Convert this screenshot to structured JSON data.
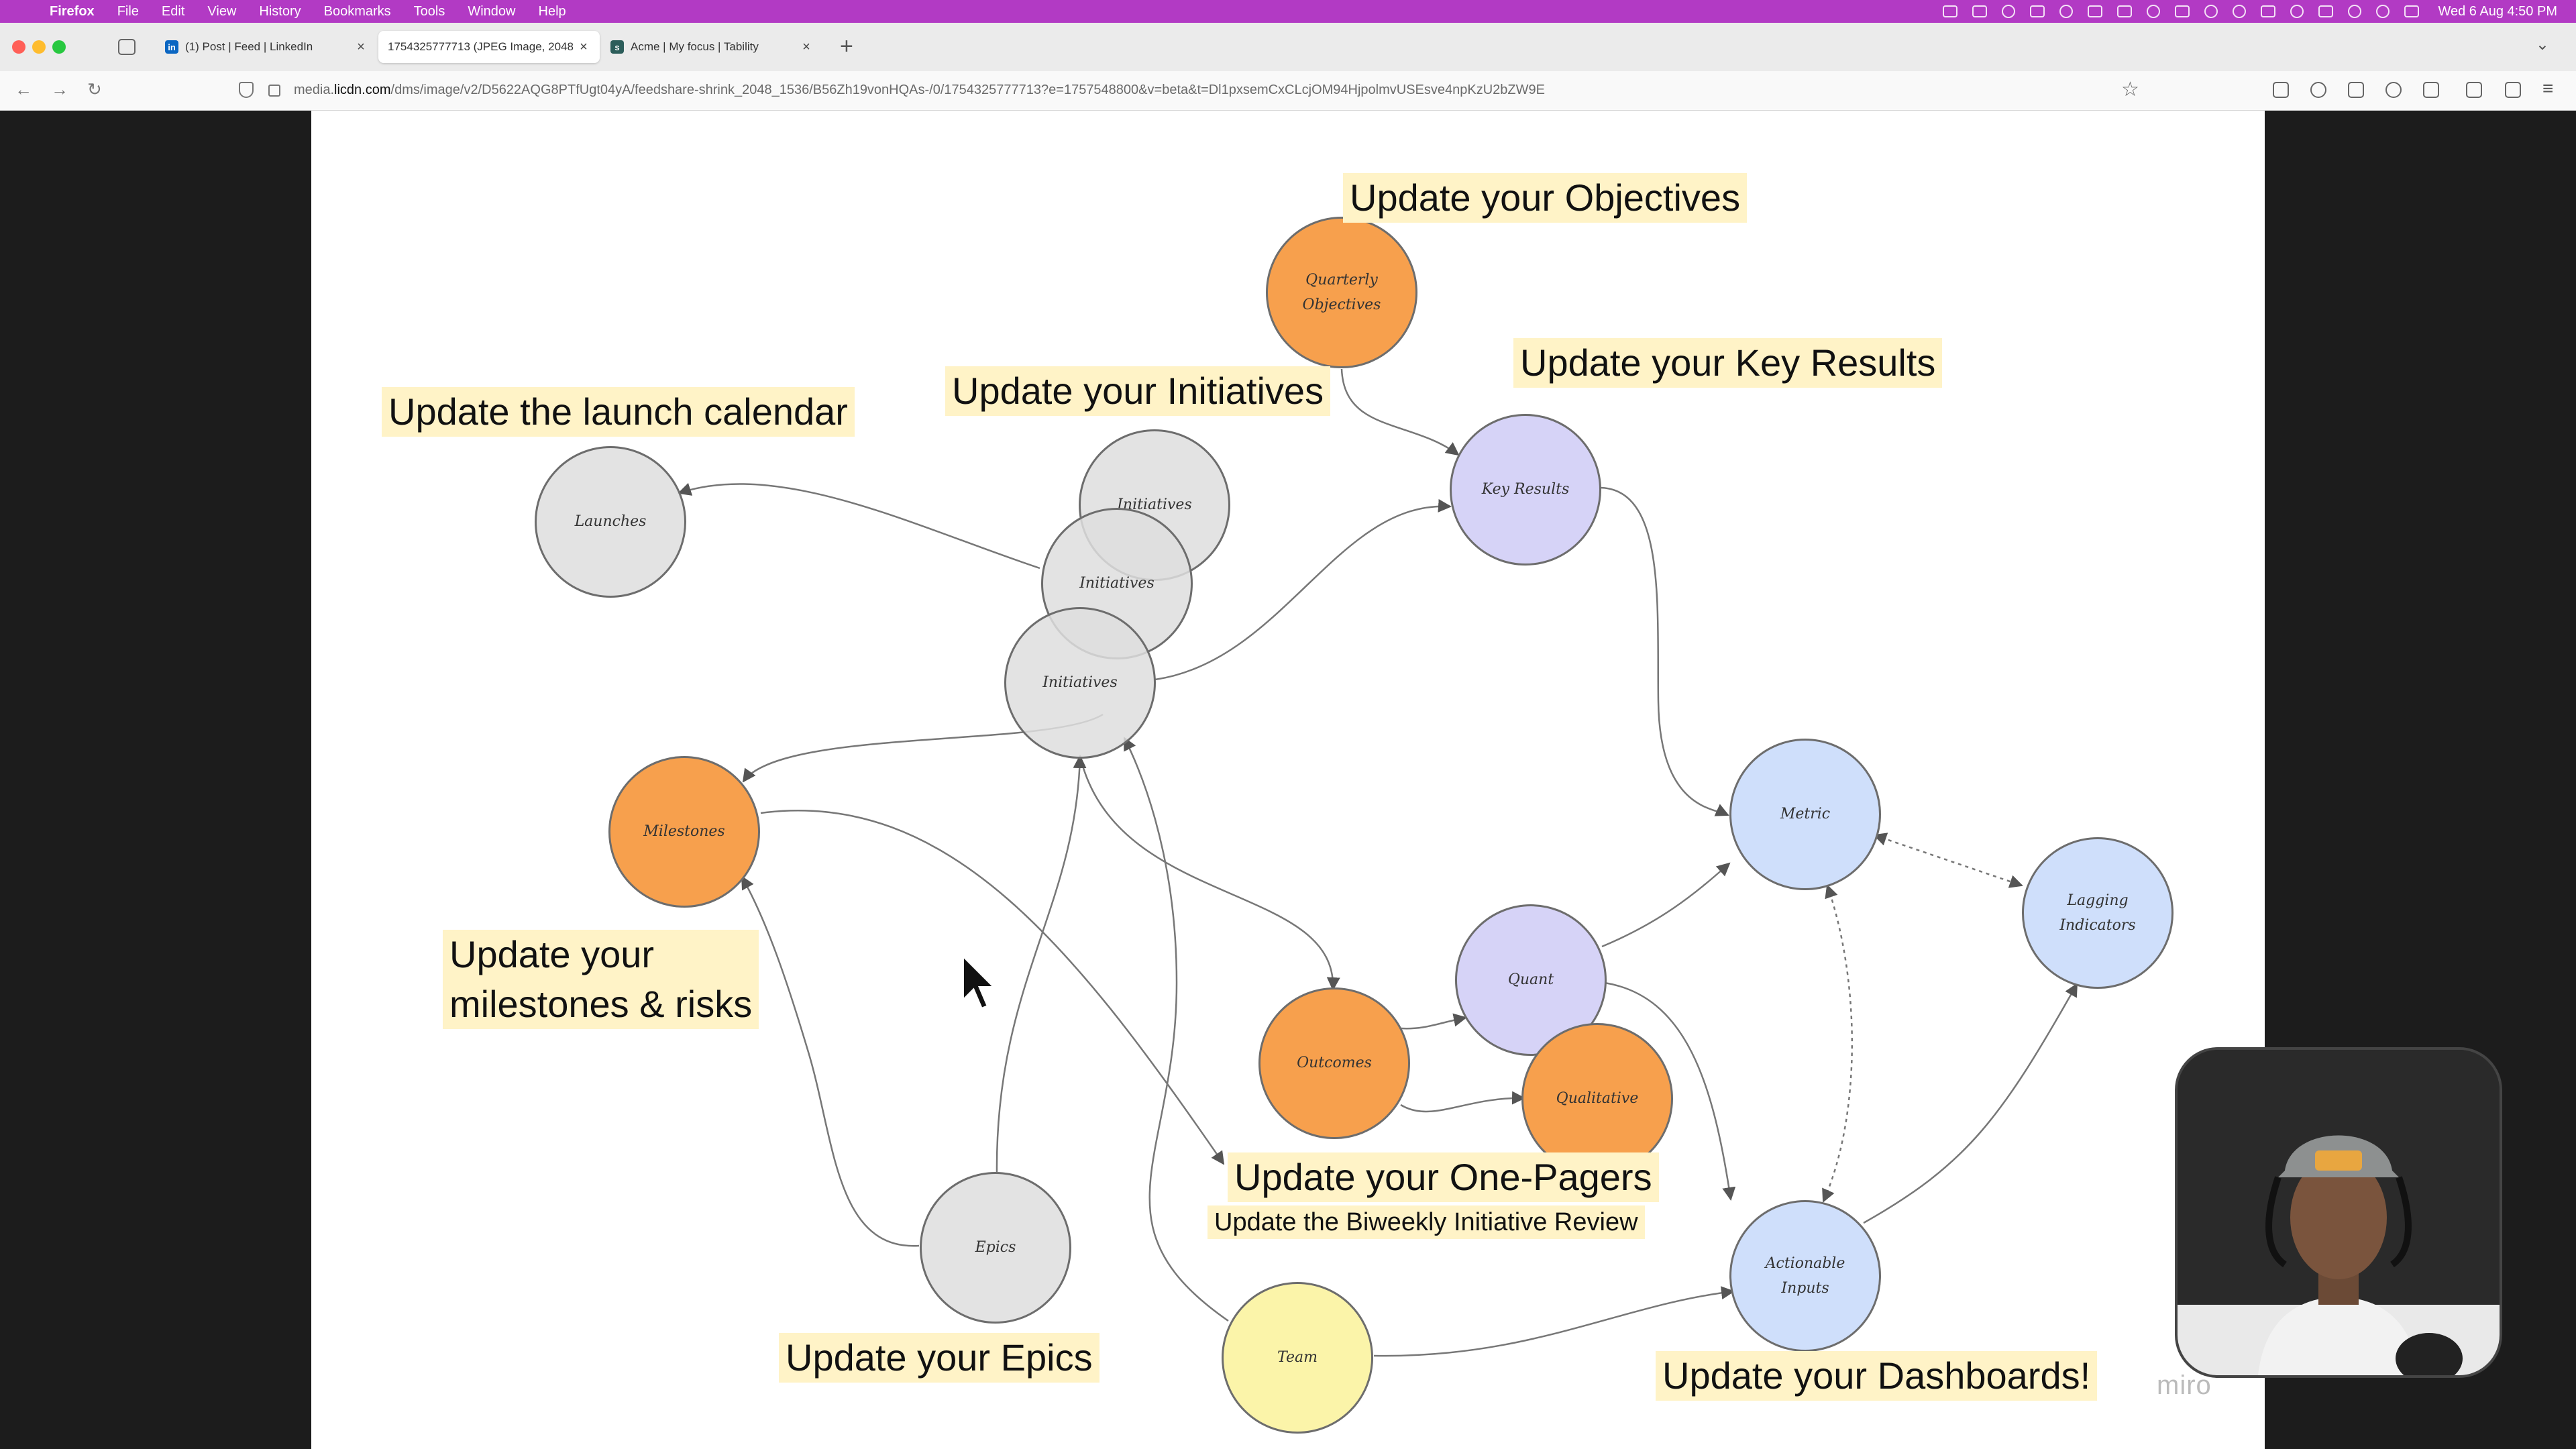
{
  "menubar": {
    "app": "Firefox",
    "items": [
      "File",
      "Edit",
      "View",
      "History",
      "Bookmarks",
      "Tools",
      "Window",
      "Help"
    ],
    "clock": "Wed 6 Aug  4:50 PM"
  },
  "tabs": [
    {
      "title": "(1) Post | Feed | LinkedIn",
      "favicon": "in",
      "color": "#0a66c2"
    },
    {
      "title": "1754325777713 (JPEG Image, 2048",
      "favicon": "",
      "color": "#ffffff"
    },
    {
      "title": "Acme | My focus | Tability",
      "favicon": "s",
      "color": "#2c5d5a"
    }
  ],
  "url": {
    "domain_prefix": "media.",
    "domain": "licdn.com",
    "path": "/dms/image/v2/D5622AQG8PTfUgt04yA/feedshare-shrink_2048_1536/B56Zh19vonHQAs-/0/1754325777713?e=1757548800&v=beta&t=Dl1pxsemCxCLcjOM94HjpolmvUSEsve4npKzU2bZW9E"
  },
  "board": {
    "nodes": {
      "quarterly": "Quarterly Objectives",
      "key_results": "Key Results",
      "initiatives": "Initiatives",
      "launches": "Launches",
      "milestones": "Milestones",
      "metric": "Metric",
      "lagging": "Lagging Indicators",
      "quant": "Quant",
      "outcomes": "Outcomes",
      "qualitative": "Qualitative",
      "epics": "Epics",
      "team": "Team",
      "actionable": "Actionable Inputs"
    },
    "labels": {
      "objectives": "Update your Objectives",
      "key_results": "Update your Key Results",
      "initiatives": "Update your Initiatives",
      "launch_calendar": "Update the launch calendar",
      "milestones_line1": "Update your",
      "milestones_line2": "milestones & risks",
      "one_pagers": "Update your One-Pagers",
      "biweekly": "Update the Biweekly Initiative Review",
      "epics": "Update your Epics",
      "dashboards": "Update your Dashboards!"
    },
    "watermark": "miro",
    "colors": {
      "orange": "#f7a04d",
      "purple": "#d6d3f7",
      "blue": "#cfdffb",
      "yellow": "#fbf4a9",
      "gray": "#dedede",
      "sticky": "#fff3c7"
    }
  }
}
